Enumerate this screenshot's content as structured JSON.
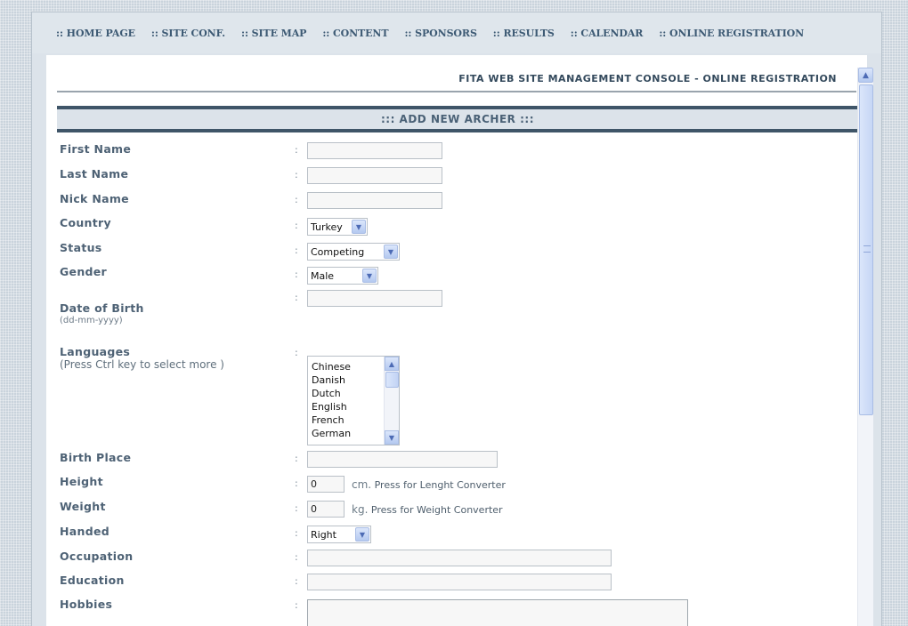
{
  "nav": [
    {
      "label": ":: HOME PAGE"
    },
    {
      "label": ":: SITE CONF."
    },
    {
      "label": ":: SITE MAP"
    },
    {
      "label": ":: CONTENT"
    },
    {
      "label": ":: SPONSORS"
    },
    {
      "label": ":: RESULTS"
    },
    {
      "label": ":: CALENDAR"
    },
    {
      "label": ":: ONLINE REGISTRATION"
    }
  ],
  "console_title": "FITA WEB SITE MANAGEMENT CONSOLE - ONLINE REGISTRATION",
  "section_title": "::: ADD NEW ARCHER :::",
  "colon": ":",
  "form": {
    "first_name": {
      "label": "First Name",
      "value": ""
    },
    "last_name": {
      "label": "Last Name",
      "value": ""
    },
    "nick_name": {
      "label": "Nick Name",
      "value": ""
    },
    "country": {
      "label": "Country",
      "selected": "Turkey"
    },
    "status": {
      "label": "Status",
      "selected": "Competing"
    },
    "gender": {
      "label": "Gender",
      "selected": "Male"
    },
    "dob": {
      "label": "Date of Birth",
      "hint": "(dd-mm-yyyy)",
      "value": ""
    },
    "languages": {
      "label": "Languages",
      "hint": "(Press Ctrl key to select more )",
      "options": [
        "Chinese",
        "Danish",
        "Dutch",
        "English",
        "French",
        "German"
      ]
    },
    "birth_place": {
      "label": "Birth Place",
      "value": ""
    },
    "height": {
      "label": "Height",
      "value": "0",
      "unit": "cm.",
      "note": "Press for Lenght Converter"
    },
    "weight": {
      "label": "Weight",
      "value": "0",
      "unit": "kg.",
      "note": "Press for Weight Converter"
    },
    "handed": {
      "label": "Handed",
      "selected": "Right"
    },
    "occupation": {
      "label": "Occupation",
      "value": ""
    },
    "education": {
      "label": "Education",
      "value": ""
    },
    "hobbies": {
      "label": "Hobbies",
      "value": ""
    }
  },
  "icons": {
    "dropdown": "chevron-down-icon",
    "scroll_up": "arrow-up-icon",
    "scroll_down": "arrow-down-icon"
  }
}
